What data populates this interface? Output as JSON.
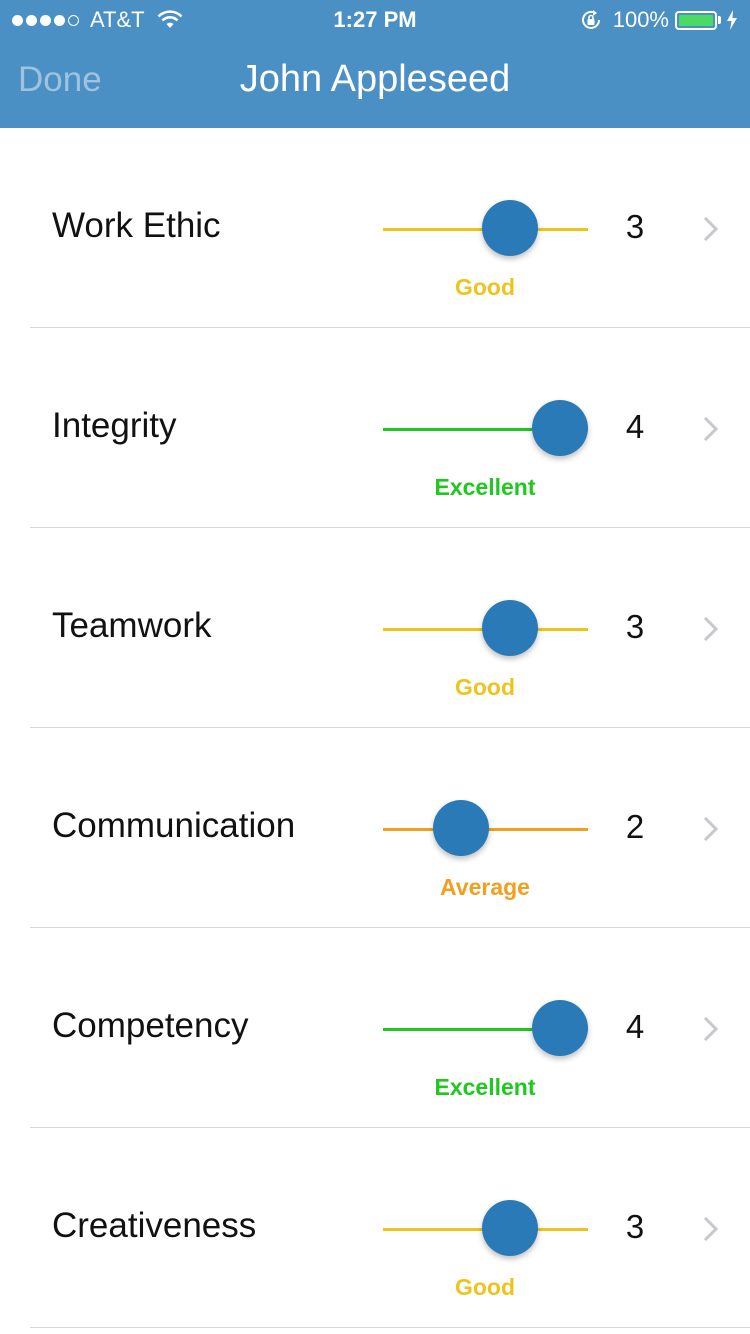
{
  "status_bar": {
    "carrier": "AT&T",
    "signal_bars_filled": 4,
    "signal_bars_total": 5,
    "time": "1:27 PM",
    "battery_percent": "100%",
    "battery_level": 1.0,
    "battery_color": "#4cd964",
    "icons": [
      "wifi-icon",
      "rotation-lock-icon",
      "battery-icon",
      "charging-bolt-icon"
    ]
  },
  "nav": {
    "done_label": "Done",
    "title": "John Appleseed",
    "background": "#4a90c4"
  },
  "rating_scale": {
    "min": 1,
    "max": 4
  },
  "rating_colors": {
    "Good": "#eec41c",
    "Excellent": "#1ec81e",
    "Average": "#f0a01e"
  },
  "thumb_color": "#2b7ab8",
  "ratings": [
    {
      "label": "Work Ethic",
      "value": 3,
      "rating": "Good"
    },
    {
      "label": "Integrity",
      "value": 4,
      "rating": "Excellent"
    },
    {
      "label": "Teamwork",
      "value": 3,
      "rating": "Good"
    },
    {
      "label": "Communication",
      "value": 2,
      "rating": "Average"
    },
    {
      "label": "Competency",
      "value": 4,
      "rating": "Excellent"
    },
    {
      "label": "Creativeness",
      "value": 3,
      "rating": "Good"
    }
  ]
}
